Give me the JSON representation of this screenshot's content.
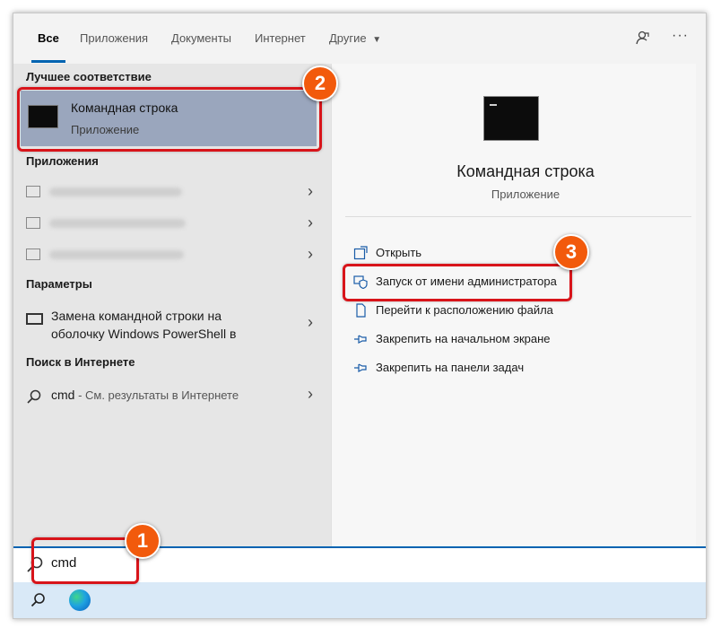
{
  "tabs": [
    "Все",
    "Приложения",
    "Документы",
    "Интернет",
    "Другие"
  ],
  "header_icons": {
    "feedback": "feedback-icon",
    "more": "more-icon"
  },
  "left": {
    "best_match_header": "Лучшее соответствие",
    "best_match": {
      "title": "Командная строка",
      "subtitle": "Приложение"
    },
    "apps_header": "Приложения",
    "settings_header": "Параметры",
    "settings_item": "Замена командной строки на оболочку Windows PowerShell в",
    "web_header": "Поиск в Интернете",
    "web_item": {
      "query": "cmd",
      "suffix": " - См. результаты в Интернете"
    }
  },
  "right": {
    "title": "Командная строка",
    "subtitle": "Приложение",
    "actions": [
      "Открыть",
      "Запуск от имени администратора",
      "Перейти к расположению файла",
      "Закрепить на начальном экране",
      "Закрепить на панели задач"
    ]
  },
  "search": {
    "value": "cmd"
  },
  "annotations": [
    "1",
    "2",
    "3"
  ],
  "colors": {
    "highlight": "#d8141a",
    "badge": "#f25a0c",
    "accent": "#0063b1"
  }
}
